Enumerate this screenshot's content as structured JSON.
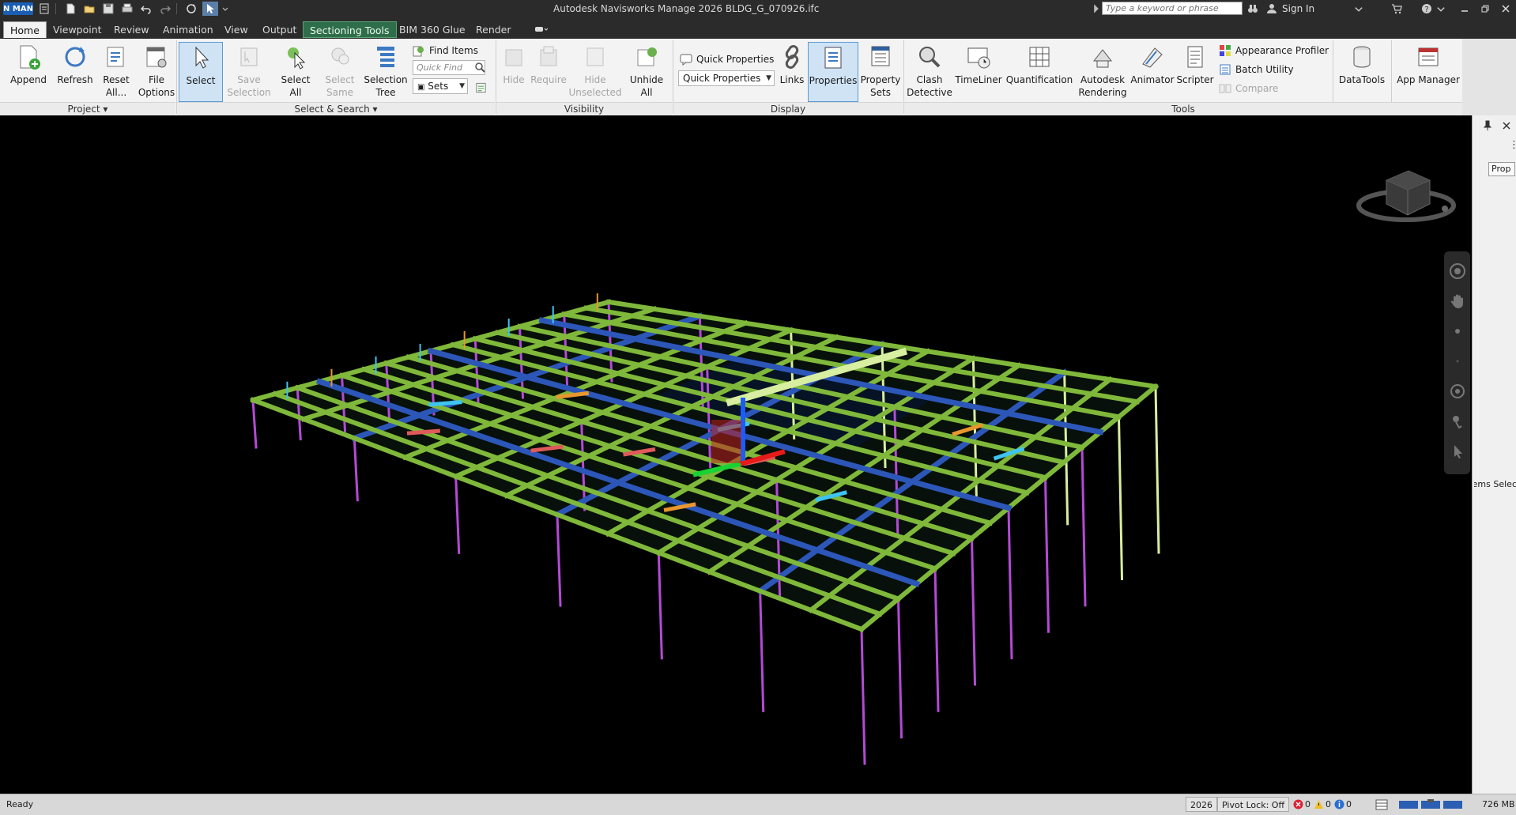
{
  "app": {
    "logo_text": "N MAN",
    "title": "Autodesk Navisworks Manage 2026    BLDG_G_070926.ifc",
    "search_placeholder": "Type a keyword or phrase",
    "signin_label": "Sign In"
  },
  "tabs": [
    {
      "label": "Home"
    },
    {
      "label": "Viewpoint"
    },
    {
      "label": "Review"
    },
    {
      "label": "Animation"
    },
    {
      "label": "View"
    },
    {
      "label": "Output"
    },
    {
      "label": "Sectioning Tools"
    },
    {
      "label": "BIM 360 Glue"
    },
    {
      "label": "Render"
    }
  ],
  "ribbon": {
    "project": {
      "append": "Append",
      "refresh": "Refresh",
      "reset_all": "Reset\nAll...",
      "file_options": "File\nOptions",
      "panel": "Project ▾"
    },
    "select_search": {
      "select": "Select",
      "save_selection": "Save\nSelection",
      "select_all": "Select\nAll",
      "select_same": "Select\nSame",
      "selection_tree": "Selection\nTree",
      "find_items": "Find Items",
      "quick_find_placeholder": "Quick Find",
      "sets": "Sets",
      "panel": "Select & Search ▾"
    },
    "visibility": {
      "hide": "Hide",
      "require": "Require",
      "hide_unselected": "Hide\nUnselected",
      "unhide_all": "Unhide\nAll",
      "panel": "Visibility"
    },
    "display": {
      "quick_properties": "Quick Properties",
      "quick_properties_select": "Quick Properties",
      "links": "Links",
      "properties": "Properties",
      "property_sets": "Property\nSets",
      "panel": "Display"
    },
    "tools": {
      "clash_detective": "Clash\nDetective",
      "timeliner": "TimeLiner",
      "quantification": "Quantification",
      "autodesk_rendering": "Autodesk\nRendering",
      "animator": "Animator",
      "scripter": "Scripter",
      "appearance_profiler": "Appearance Profiler",
      "batch_utility": "Batch Utility",
      "compare": "Compare",
      "datatools": "DataTools",
      "app_manager": "App Manager",
      "panel": "Tools"
    }
  },
  "dock": {
    "prop_tab": "Prop",
    "items_selected": "Items Selec"
  },
  "status": {
    "text": "Ready",
    "year": "2026",
    "pivot_lock": "Pivot Lock: Off",
    "errors": "0",
    "warnings": "0",
    "info": "0",
    "memory": "726 MB"
  },
  "colors": {
    "slab_beam_green": "#7fb83a",
    "column_purple": "#b44ad6",
    "beam_blue": "#2c56b8",
    "accent_red": "#e05a5a",
    "orange_member": "#e8962e",
    "cyan_member": "#3ec4f0",
    "pale_green": "#d8eea0"
  }
}
